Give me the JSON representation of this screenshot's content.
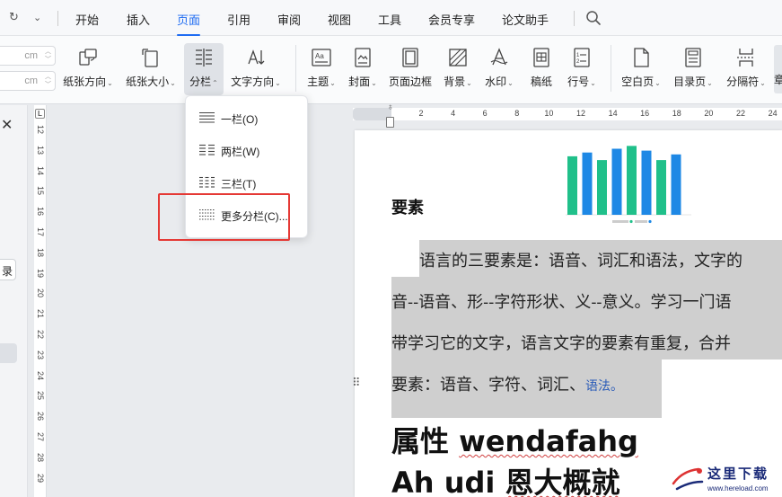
{
  "menubar": {
    "quick_redo_icon": "redo-icon",
    "quick_more_icon": "chevron-down-icon",
    "tabs": [
      {
        "label": "开始"
      },
      {
        "label": "插入"
      },
      {
        "label": "页面"
      },
      {
        "label": "引用"
      },
      {
        "label": "审阅"
      },
      {
        "label": "视图"
      },
      {
        "label": "工具"
      },
      {
        "label": "会员专享"
      },
      {
        "label": "论文助手"
      }
    ],
    "active_tab": "页面",
    "accent_color": "#1f6cf2"
  },
  "ribbon": {
    "margin_spinners": [
      {
        "unit": "cm"
      },
      {
        "unit": "cm"
      }
    ],
    "buttons": [
      {
        "label": "纸张方向",
        "icon": "page-orientation-icon"
      },
      {
        "label": "纸张大小",
        "icon": "paper-size-icon"
      },
      {
        "label": "分栏",
        "icon": "columns-icon"
      },
      {
        "label": "文字方向",
        "icon": "text-direction-icon"
      },
      {
        "label": "主题",
        "icon": "theme-icon"
      },
      {
        "label": "封面",
        "icon": "cover-page-icon"
      },
      {
        "label": "页面边框",
        "icon": "page-border-icon"
      },
      {
        "label": "背景",
        "icon": "background-icon"
      },
      {
        "label": "水印",
        "icon": "watermark-icon"
      },
      {
        "label": "稿纸",
        "icon": "manuscript-paper-icon"
      },
      {
        "label": "行号",
        "icon": "line-numbers-icon"
      },
      {
        "label": "空白页",
        "icon": "blank-page-icon"
      },
      {
        "label": "目录页",
        "icon": "toc-page-icon"
      },
      {
        "label": "分隔符",
        "icon": "separator-icon"
      }
    ],
    "edge_button_label": "章"
  },
  "dropdown": {
    "items": [
      {
        "label": "一栏(O)",
        "icon": "one-column-icon"
      },
      {
        "label": "两栏(W)",
        "icon": "two-columns-icon"
      },
      {
        "label": "三栏(T)",
        "icon": "three-columns-icon"
      },
      {
        "label": "更多分栏(C)...",
        "icon": "more-columns-icon"
      }
    ],
    "highlight_color": "#e53935"
  },
  "left_panel": {
    "close_icon": "close-icon",
    "chip_label": "录"
  },
  "vertical_ruler": {
    "corner_label": "L",
    "numbers": [
      "12",
      "13",
      "14",
      "15",
      "16",
      "17",
      "18",
      "19",
      "20",
      "21",
      "22",
      "23",
      "24",
      "25",
      "26",
      "27",
      "28",
      "29"
    ]
  },
  "horizontal_ruler": {
    "numbers": [
      "2",
      "4",
      "6",
      "8",
      "10",
      "12",
      "14",
      "16",
      "18",
      "20",
      "22",
      "24"
    ]
  },
  "document": {
    "heading": "要素",
    "paragraph_lines": [
      "语言的三要素是：语音、词汇和语法，文字的",
      "音--语音、形--字符形状、义--意义。学习一门语",
      "带学习它的文字，语言文字的要素有重复，合并",
      "要素：语音、字符、词汇、"
    ],
    "paragraph_tail": "语法。",
    "big_line1_cn": "属性 ",
    "big_line1_en": "wendafahg",
    "big_line2_en": "Ah udi ",
    "big_line2_cn": "恩大概就",
    "highlight_color": "#cfcfcf"
  },
  "chart_data": {
    "type": "bar",
    "values": [
      62,
      66,
      58,
      70,
      73,
      68,
      58,
      64
    ],
    "ylim": [
      0,
      80
    ],
    "colors": [
      "#20c08a",
      "#1e88e5",
      "#20c08a",
      "#1e88e5",
      "#20c08a",
      "#1e88e5",
      "#20c08a",
      "#1e88e5"
    ]
  },
  "watermark": {
    "title": "这里下载",
    "url": "www.hereload.com"
  }
}
